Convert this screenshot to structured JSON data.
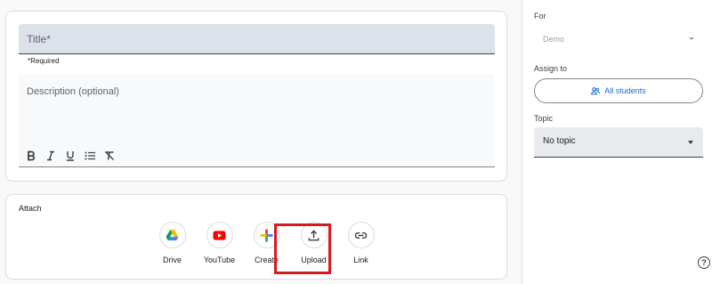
{
  "form": {
    "title_placeholder": "Title*",
    "required_note": "*Required",
    "description_placeholder": "Description (optional)",
    "format_buttons": [
      "bold",
      "italic",
      "underline",
      "bulleted-list",
      "clear-formatting"
    ]
  },
  "attach": {
    "label": "Attach",
    "items": [
      {
        "label": "Drive",
        "icon": "drive-icon"
      },
      {
        "label": "YouTube",
        "icon": "youtube-icon"
      },
      {
        "label": "Create",
        "icon": "create-icon"
      },
      {
        "label": "Upload",
        "icon": "upload-icon"
      },
      {
        "label": "Link",
        "icon": "link-icon"
      }
    ],
    "highlighted": "Upload",
    "highlight_color": "#d71920"
  },
  "sidebar": {
    "for_label": "For",
    "for_value": "Demo",
    "assign_label": "Assign to",
    "assign_button": "All students",
    "topic_label": "Topic",
    "topic_value": "No topic",
    "help": "?"
  },
  "colors": {
    "accent": "#1967d2",
    "youtube": "#ff0000"
  }
}
